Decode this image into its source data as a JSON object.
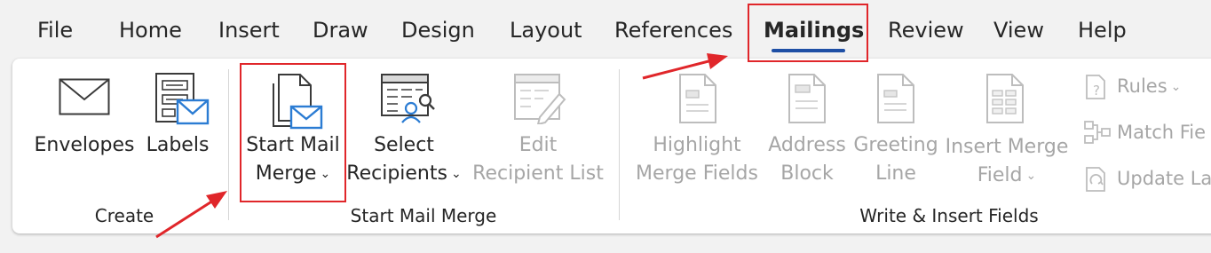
{
  "tabs": [
    "File",
    "Home",
    "Insert",
    "Draw",
    "Design",
    "Layout",
    "References",
    "Mailings",
    "Review",
    "View",
    "Help"
  ],
  "active_tab": "Mailings",
  "groups": {
    "create": {
      "label": "Create",
      "envelopes": "Envelopes",
      "labels": "Labels"
    },
    "start_mail_merge": {
      "label": "Start Mail Merge",
      "start_line1": "Start Mail",
      "start_line2": "Merge",
      "select_line1": "Select",
      "select_line2": "Recipients",
      "edit_line1": "Edit",
      "edit_line2": "Recipient List"
    },
    "write_insert": {
      "label": "Write & Insert Fields",
      "highlight_line1": "Highlight",
      "highlight_line2": "Merge Fields",
      "address_line1": "Address",
      "address_line2": "Block",
      "greeting_line1": "Greeting",
      "greeting_line2": "Line",
      "insert_line1": "Insert Merge",
      "insert_line2": "Field",
      "rules": "Rules",
      "match_fields": "Match Fie",
      "update_labels": "Update La"
    }
  },
  "colors": {
    "accent": "#1e4fa5",
    "envelope_blue": "#2b7cd3",
    "annotation_red": "#e0262a",
    "disabled_text": "#a6a6a6"
  },
  "icons": {
    "envelopes": "envelope-icon",
    "labels": "labels-icon",
    "start_mail_merge": "start-mail-merge-icon",
    "select_recipients": "select-recipients-icon",
    "edit_recipient_list": "edit-recipient-list-icon",
    "highlight": "highlight-merge-fields-icon",
    "address": "address-block-icon",
    "greeting": "greeting-line-icon",
    "insert_field": "insert-merge-field-icon",
    "rules": "rules-icon",
    "match": "match-fields-icon",
    "update": "update-labels-icon"
  }
}
